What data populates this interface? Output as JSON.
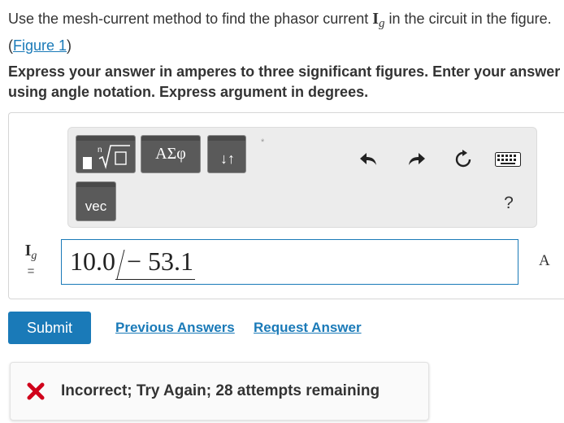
{
  "question": {
    "text_before": "Use the mesh-current method to find the phasor current ",
    "symbol": "I",
    "subscript": "g",
    "text_after": " in the circuit in the figure.(",
    "figure_link": "Figure 1",
    "text_close": ")"
  },
  "instructions": "Express your answer in amperes to three significant figures. Enter your answer using angle notation. Express argument in degrees.",
  "toolbar": {
    "greek_label": "ΑΣφ",
    "vec_label": "vec",
    "arrows_glyph": "↓↑",
    "star": "*",
    "help_label": "?"
  },
  "answer": {
    "label_symbol": "I",
    "label_subscript": "g",
    "label_equals": "=",
    "magnitude": "10.0",
    "angle": "− 53.1",
    "unit": "A"
  },
  "actions": {
    "submit_label": "Submit",
    "previous_answers_label": "Previous Answers",
    "request_answer_label": "Request Answer"
  },
  "feedback": {
    "message": "Incorrect; Try Again; 28 attempts remaining",
    "status_color": "#d0021b"
  },
  "colors": {
    "accent": "#1a7ab8",
    "toolbar_button": "#5a5a5a"
  }
}
